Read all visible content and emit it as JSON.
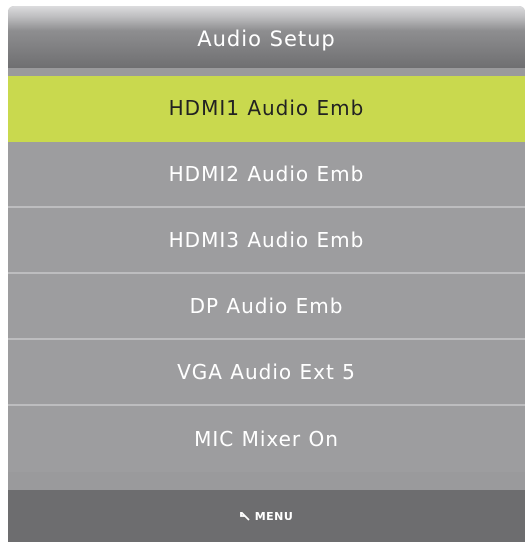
{
  "header": {
    "title": "Audio Setup"
  },
  "menu": {
    "items": [
      {
        "label": "HDMI1 Audio Emb",
        "selected": true
      },
      {
        "label": "HDMI2 Audio Emb",
        "selected": false
      },
      {
        "label": "HDMI3 Audio Emb",
        "selected": false
      },
      {
        "label": "DP Audio Emb",
        "selected": false
      },
      {
        "label": "VGA Audio Ext 5",
        "selected": false
      },
      {
        "label": "MIC Mixer On",
        "selected": false
      }
    ]
  },
  "footer": {
    "menu_label": "MENU",
    "icon": "back-arrow-icon"
  },
  "colors": {
    "highlight": "#c9d94e",
    "item_background": "#9d9d9f",
    "footer_background": "#6d6d6f",
    "text": "#ffffff"
  }
}
